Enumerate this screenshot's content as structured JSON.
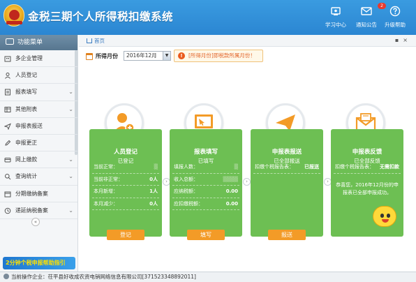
{
  "app": {
    "title": "金税三期个人所得税扣缴系统"
  },
  "header": {
    "buttons": [
      {
        "label": "学习中心",
        "icon": "graduation-icon"
      },
      {
        "label": "通知公告",
        "icon": "mail-icon",
        "badge": "2"
      },
      {
        "label": "升级帮助",
        "icon": "help-icon"
      }
    ]
  },
  "sidebar": {
    "title": "功能菜单",
    "items": [
      {
        "label": "多企业管理",
        "icon": "building-icon",
        "expandable": false
      },
      {
        "label": "人员登记",
        "icon": "person-icon",
        "expandable": false
      },
      {
        "label": "报表填写",
        "icon": "form-icon",
        "expandable": true
      },
      {
        "label": "其他附表",
        "icon": "table-icon",
        "expandable": true
      },
      {
        "label": "申报表报送",
        "icon": "send-icon",
        "expandable": false
      },
      {
        "label": "申报更正",
        "icon": "edit-icon",
        "expandable": false
      },
      {
        "label": "网上缴款",
        "icon": "payment-icon",
        "expandable": true
      },
      {
        "label": "查询统计",
        "icon": "search-icon",
        "expandable": true
      },
      {
        "label": "分期缴纳备案",
        "icon": "calendar-icon",
        "expandable": false
      },
      {
        "label": "递延纳税备案",
        "icon": "clock-icon",
        "expandable": true
      }
    ],
    "promo": "2分钟个税申报帮助指引"
  },
  "tabs": {
    "home": "首页"
  },
  "period": {
    "label": "所得月份",
    "value": "2016年12月"
  },
  "notice": "[所得月份]即税款所属月份！",
  "cards": [
    {
      "title": "人员登记",
      "status": "已登记",
      "icon": "add-user-icon",
      "rows": [
        {
          "k": "当前正常：",
          "v": "",
          "blurred": true
        },
        {
          "k": "当前非正常：",
          "v": "0人"
        },
        {
          "k": "本月新增：",
          "v": "1人"
        },
        {
          "k": "本月减少：",
          "v": "0人"
        }
      ],
      "button": "登记"
    },
    {
      "title": "报表填写",
      "status": "已填写",
      "icon": "form-fill-icon",
      "rows": [
        {
          "k": "填报人数：",
          "v": "",
          "blurred": true
        },
        {
          "k": "收入总额：",
          "v": "",
          "blurred": true
        },
        {
          "k": "应纳税额：",
          "v": "0.00"
        },
        {
          "k": "应扣缴税额：",
          "v": "0.00"
        }
      ],
      "button": "填写"
    },
    {
      "title": "申报表报送",
      "status": "已全部报送",
      "icon": "paper-plane-icon",
      "rows": [
        {
          "k": "扣缴个税报告表：",
          "v": "已报送"
        }
      ],
      "button": "报送"
    },
    {
      "title": "申报表反馈",
      "status": "已全部反馈",
      "icon": "envelope-icon",
      "rows": [
        {
          "k": "扣缴个税报告表：",
          "v": "无需扣款"
        }
      ],
      "message": "恭喜您，2016年12月份的申报表已全部申报成功。"
    }
  ],
  "footer": {
    "prefix": "当前操作企业：",
    "company": "茌平县好收成农资电销网络信息有限公司[371523348892011]"
  },
  "colors": {
    "header": "#2b86d2",
    "card": "#6dbf53",
    "button": "#f39b27",
    "notice": "#e2652a"
  }
}
